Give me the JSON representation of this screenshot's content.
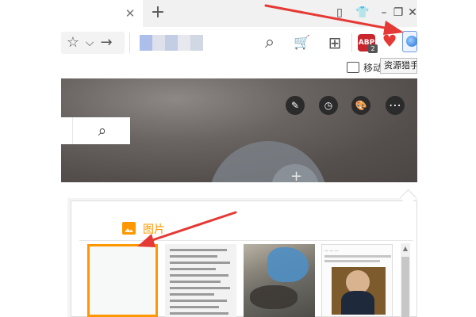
{
  "browser": {
    "tab_close": "✕",
    "new_tab": "+",
    "window_controls": [
      {
        "name": "mini-window-icon",
        "glyph": "▯"
      },
      {
        "name": "skin-icon",
        "glyph": "👕"
      },
      {
        "name": "minimize-icon",
        "glyph": "–"
      },
      {
        "name": "restore-icon",
        "glyph": "❐"
      },
      {
        "name": "close-window-icon",
        "glyph": "✕"
      }
    ]
  },
  "toolbar": {
    "icons": {
      "favorite": "☆",
      "dropdown": "⌵",
      "forward": "→",
      "search": "⌕",
      "cart": "🛒",
      "apps": "⊞",
      "abp": "ABP",
      "abp_count": "2",
      "heart": "♥"
    }
  },
  "secondary": {
    "mobile_label": "移动",
    "tooltip": "资源猎手"
  },
  "hero": {
    "buttons": [
      {
        "name": "edit-icon",
        "glyph": "✎"
      },
      {
        "name": "history-icon",
        "glyph": "◷"
      },
      {
        "name": "palette-icon",
        "glyph": "🎨"
      },
      {
        "name": "more-icon",
        "glyph": "⋯"
      }
    ],
    "search_icon": "⌕",
    "plus": "+"
  },
  "panel": {
    "tab_label": "图片",
    "thumb4_caption": "... ... ..."
  },
  "colors": {
    "accent": "#ff9800",
    "annotation_arrow": "#e53935",
    "hero_bg": "#5a5552"
  }
}
